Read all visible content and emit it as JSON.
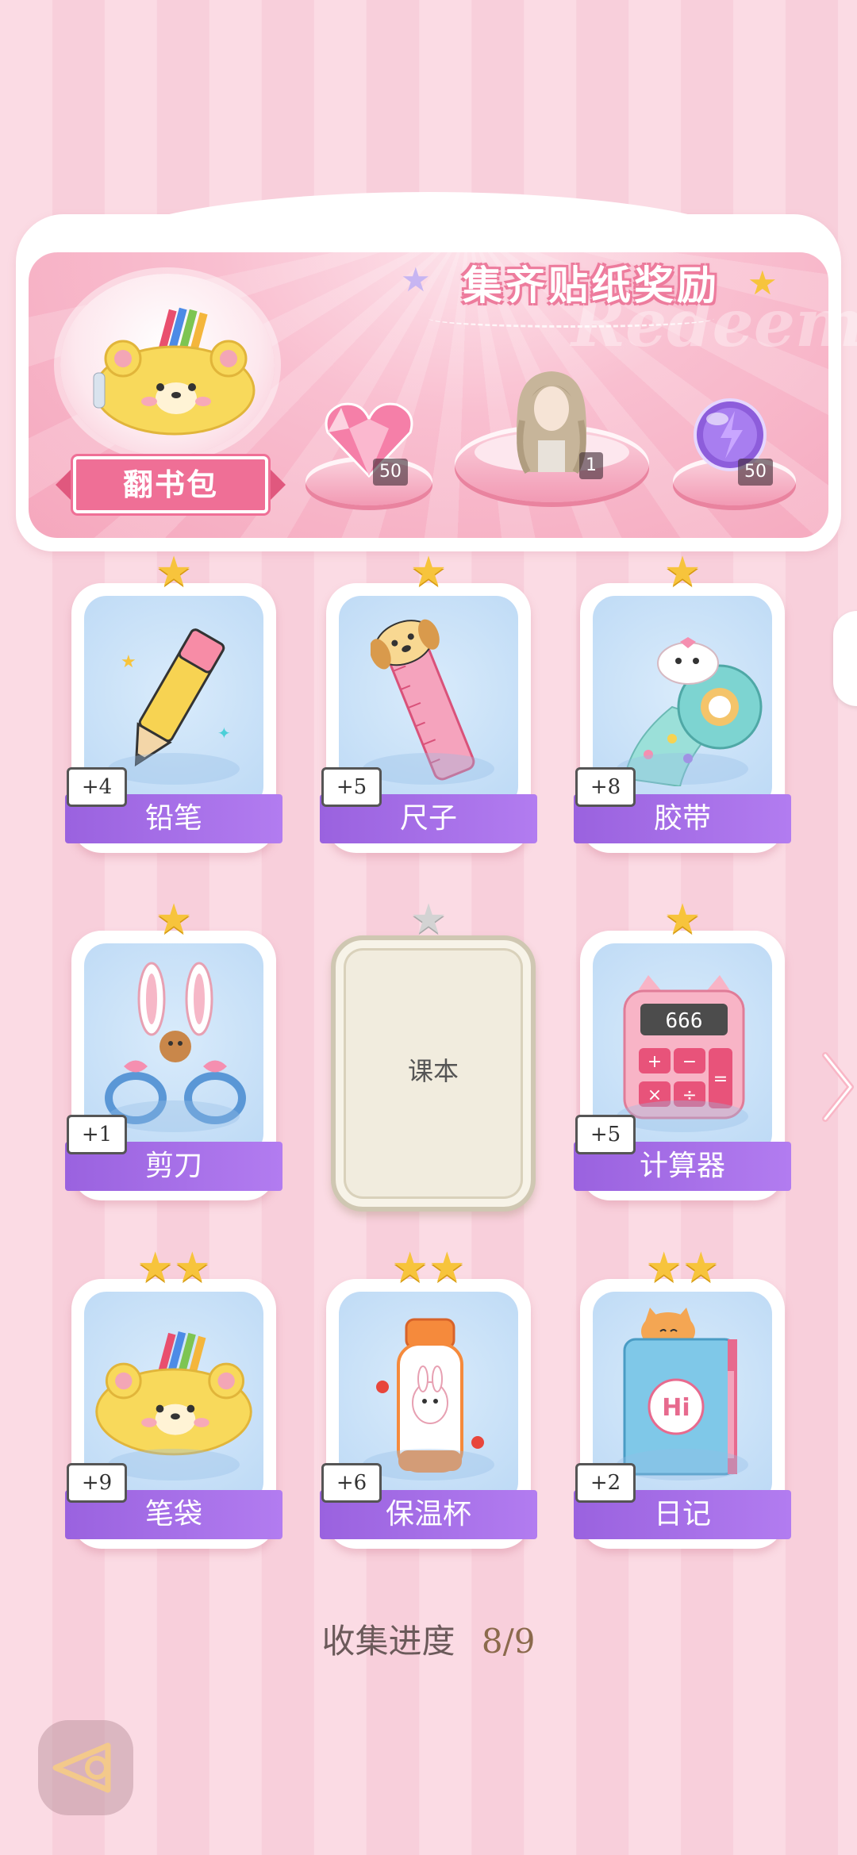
{
  "banner": {
    "title": "集齐贴纸奖励",
    "watermark": "Redeem",
    "bag_button": "翻书包",
    "rewards": [
      {
        "icon": "pink-heart-diamond-icon",
        "count": "50"
      },
      {
        "icon": "character-portrait-icon",
        "count": "1"
      },
      {
        "icon": "purple-energy-orb-icon",
        "count": "50"
      }
    ]
  },
  "cards": [
    {
      "label": "铅笔",
      "bonus": "+4",
      "stars": 1,
      "icon": "pencil-icon"
    },
    {
      "label": "尺子",
      "bonus": "+5",
      "stars": 1,
      "icon": "ruler-icon"
    },
    {
      "label": "胶带",
      "bonus": "+8",
      "stars": 1,
      "icon": "tape-icon"
    },
    {
      "label": "剪刀",
      "bonus": "+1",
      "stars": 1,
      "icon": "scissors-icon"
    },
    {
      "label": "课本",
      "bonus": "",
      "stars": 1,
      "icon": "textbook-locked",
      "locked": true
    },
    {
      "label": "计算器",
      "bonus": "+5",
      "stars": 1,
      "icon": "calculator-icon"
    },
    {
      "label": "笔袋",
      "bonus": "+9",
      "stars": 2,
      "icon": "pencil-case-icon"
    },
    {
      "label": "保温杯",
      "bonus": "+6",
      "stars": 2,
      "icon": "thermos-icon"
    },
    {
      "label": "日记",
      "bonus": "+2",
      "stars": 2,
      "icon": "diary-icon"
    }
  ],
  "progress": {
    "label": "收集进度",
    "value": "8/9"
  },
  "colors": {
    "accent": "#ef6f96",
    "label_purple": "#a36ae6",
    "star": "#f7c43c"
  }
}
